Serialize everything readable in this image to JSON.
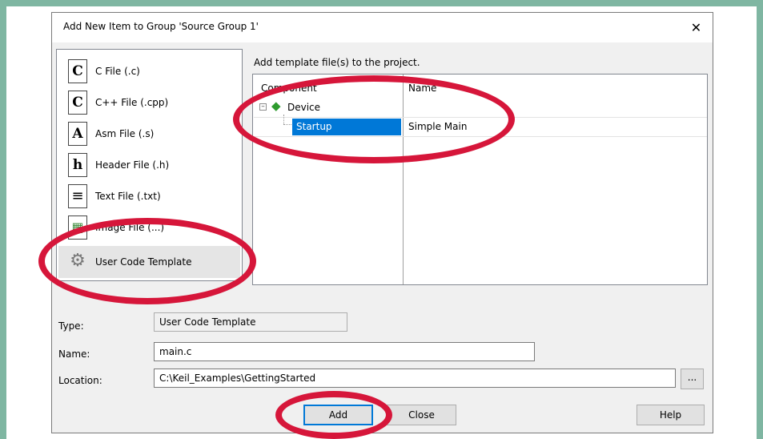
{
  "dialog": {
    "title": "Add New Item to Group 'Source Group 1'",
    "close_glyph": "✕"
  },
  "file_types": [
    {
      "label": "C File (.c)",
      "icon": "c-file-icon",
      "glyph": "C"
    },
    {
      "label": "C++ File (.cpp)",
      "icon": "cpp-file-icon",
      "glyph": "C"
    },
    {
      "label": "Asm File (.s)",
      "icon": "asm-file-icon",
      "glyph": "A"
    },
    {
      "label": "Header File (.h)",
      "icon": "header-file-icon",
      "glyph": "h"
    },
    {
      "label": "Text File (.txt)",
      "icon": "text-file-icon",
      "glyph": "≡"
    },
    {
      "label": "Image File (...)",
      "icon": "image-file-icon",
      "glyph": "▦"
    },
    {
      "label": "User Code Template",
      "icon": "gears-icon",
      "glyph": "⚙"
    }
  ],
  "selected_file_type": "User Code Template",
  "template_panel": {
    "label": "Add template file(s) to the project.",
    "column_component": "Component",
    "column_name": "Name",
    "tree": {
      "group": "Device",
      "group_icon": "diamond-icon",
      "expander": "⊟",
      "child": "Startup",
      "child_name": "Simple Main"
    }
  },
  "form": {
    "type_label": "Type:",
    "type_value": "User Code Template",
    "name_label": "Name:",
    "name_value": "main.c",
    "location_label": "Location:",
    "location_value": "C:\\Keil_Examples\\GettingStarted",
    "browse_label": "..."
  },
  "buttons": {
    "add": "Add",
    "close": "Close",
    "help": "Help"
  },
  "colors": {
    "frame": "#7fb6a2",
    "annotation": "#d6163a",
    "selection": "#0078d7"
  }
}
